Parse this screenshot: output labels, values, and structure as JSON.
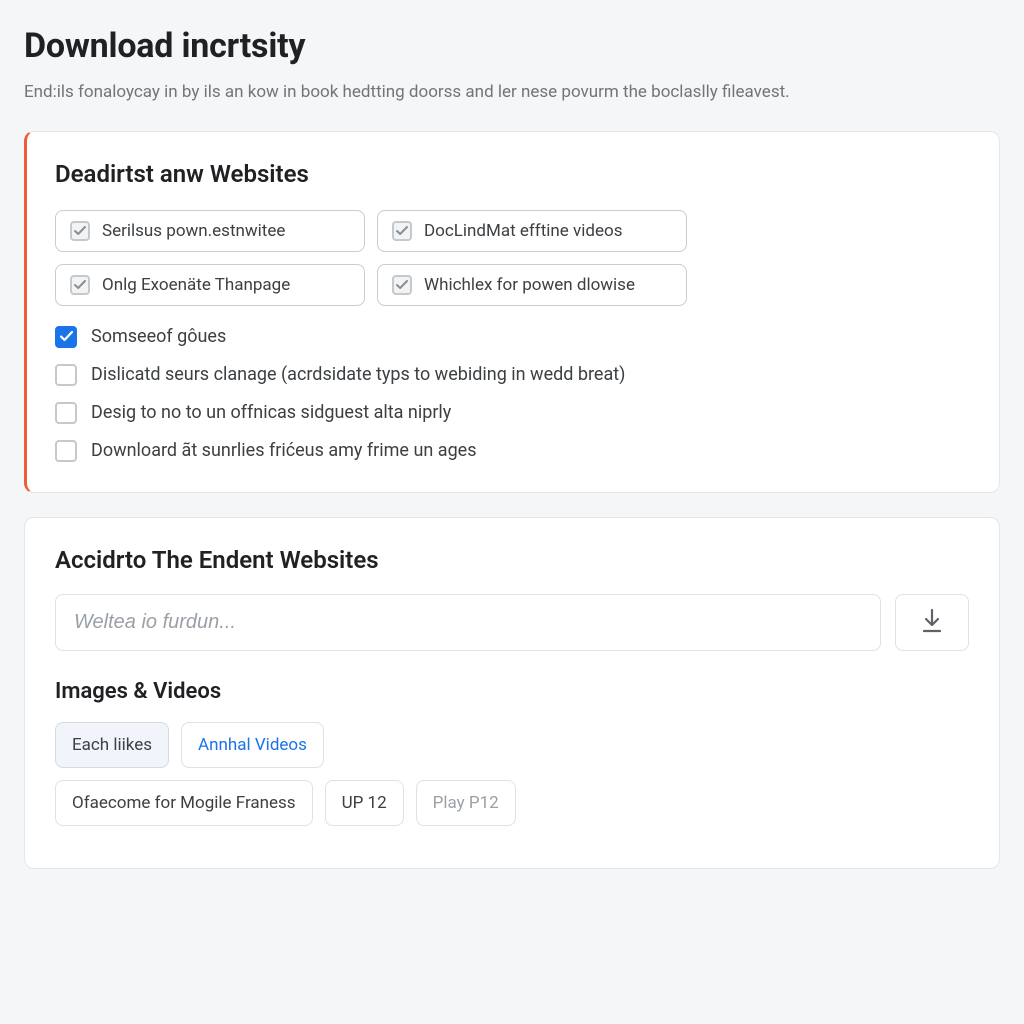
{
  "page": {
    "title": "Download incrtsity",
    "subtitle": "End:ils fonaloycay in by ils an kow in book hedtting doorss and ler nese povurm the boclaslly fileavest."
  },
  "card1": {
    "title": "Deadirtst anw Websites",
    "pills": [
      {
        "label": "Serilsus pown.estnwitee",
        "checked": true
      },
      {
        "label": "DocLindMat efftine videos",
        "checked": true
      },
      {
        "label": "Onlg Exoenäte Thanpage",
        "checked": true
      },
      {
        "label": "Whichlex for powen dlowise",
        "checked": true
      }
    ],
    "rows": [
      {
        "label": "Somseeof gôues",
        "checked": true,
        "style": "blue"
      },
      {
        "label": "Dislicatd seurs clanage (acrdsidate typs to webiding in wedd breat)",
        "checked": false
      },
      {
        "label": "Desig to no to un offnicas sidguest alta niprly",
        "checked": false
      },
      {
        "label": "Downloard ãt sunrlies frićeus amy frime un ages",
        "checked": false
      }
    ]
  },
  "card2": {
    "title": "Accidrto The Endent Websites",
    "search_placeholder": "Weltea io furdun...",
    "download_icon": "download-icon",
    "sub_title": "Images & Videos",
    "row1": [
      {
        "label": "Each liikes",
        "active": true
      },
      {
        "label": "Annhal Videos",
        "accent": true
      }
    ],
    "row2": [
      {
        "label": "Ofaecome for Mogile Franess"
      },
      {
        "label": "UP 12"
      },
      {
        "label": "Play P12",
        "muted": true
      }
    ]
  }
}
